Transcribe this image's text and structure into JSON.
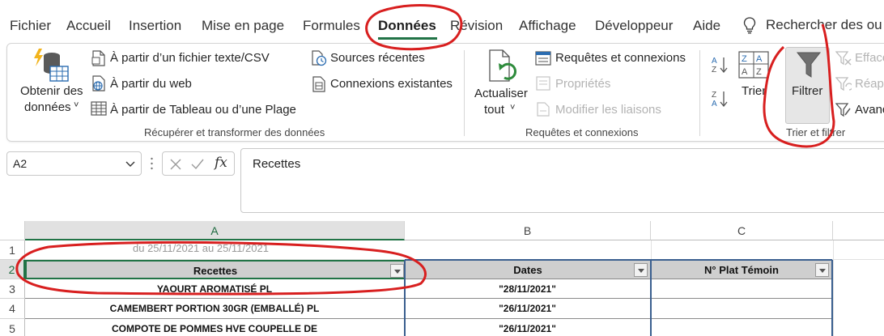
{
  "tabs": [
    {
      "label": "Fichier"
    },
    {
      "label": "Accueil"
    },
    {
      "label": "Insertion"
    },
    {
      "label": "Mise en page"
    },
    {
      "label": "Formules"
    },
    {
      "label": "Données"
    },
    {
      "label": "Révision"
    },
    {
      "label": "Affichage"
    },
    {
      "label": "Développeur"
    },
    {
      "label": "Aide"
    }
  ],
  "search": {
    "label": "Rechercher des ou"
  },
  "ribbon": {
    "get_data": {
      "line1": "Obtenir des",
      "line2": "données",
      "caret": "˅"
    },
    "from_text": "À partir d’un fichier texte/CSV",
    "from_web": "À partir du web",
    "from_table": "À partir de Tableau ou d’une Plage",
    "recent_sources": "Sources récentes",
    "existing_connections": "Connexions existantes",
    "group_get_transform": "Récupérer et transformer des données",
    "refresh_all": {
      "line1": "Actualiser",
      "line2": "tout",
      "caret": "˅"
    },
    "queries_connections": "Requêtes et connexions",
    "properties": "Propriétés",
    "edit_links": "Modifier les liaisons",
    "group_queries": "Requêtes et connexions",
    "sort": "Trier",
    "filter": "Filtrer",
    "clear": "Efface",
    "reapply": "Réappl",
    "advanced": "Avanc",
    "group_sort_filter": "Trier et filtrer"
  },
  "formula_bar": {
    "name_box": "A2",
    "fx": "fx",
    "formula": "Recettes"
  },
  "grid": {
    "columns": [
      "A",
      "B",
      "C"
    ],
    "rows": [
      "1",
      "2",
      "3",
      "4",
      "5"
    ],
    "row1_text": "du 25/11/2021 au 25/11/2021",
    "headers": [
      "Recettes",
      "Dates",
      "N° Plat Témoin"
    ],
    "data": [
      {
        "recette": "YAOURT AROMATISÉ PL",
        "date": "\"28/11/2021\"",
        "plat": ""
      },
      {
        "recette": "CAMEMBERT PORTION 30GR (EMBALLÉ)  PL",
        "date": "\"26/11/2021\"",
        "plat": ""
      },
      {
        "recette": "COMPOTE DE POMMES HVE COUPELLE DE",
        "date": "\"26/11/2021\"",
        "plat": ""
      }
    ]
  },
  "colors": {
    "accent": "#217346",
    "annotation": "#d81f1f",
    "table_border": "#3a5f8f"
  }
}
